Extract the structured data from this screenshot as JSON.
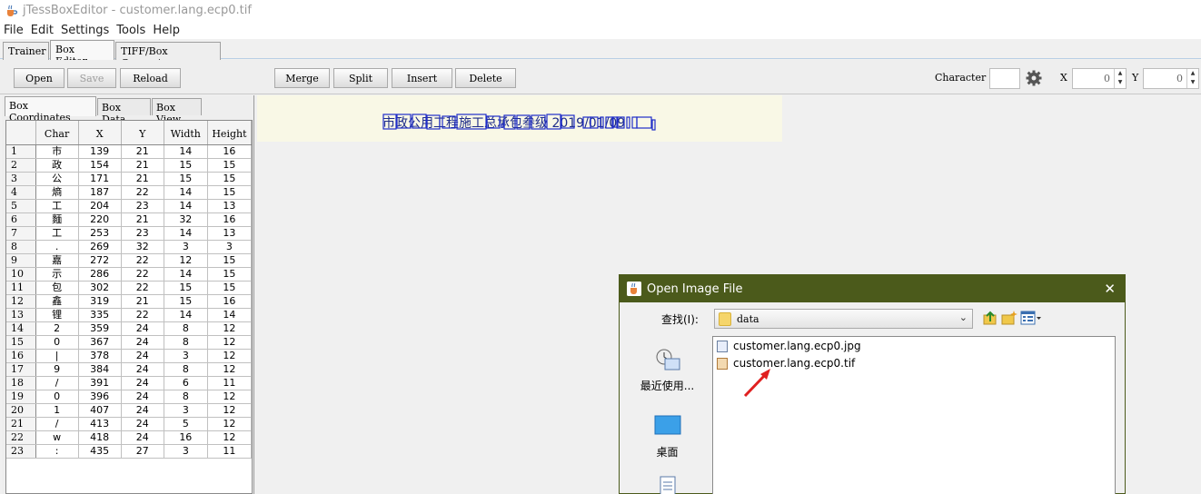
{
  "window": {
    "title": "jTessBoxEditor - customer.lang.ecp0.tif",
    "icon": "java-cup-icon"
  },
  "menubar": {
    "items": [
      "File",
      "Edit",
      "Settings",
      "Tools",
      "Help"
    ]
  },
  "main_tabs": {
    "items": [
      "Trainer",
      "Box Editor",
      "TIFF/Box Generator"
    ],
    "active": "Box Editor"
  },
  "toolbar": {
    "open": "Open",
    "save": "Save",
    "reload": "Reload",
    "merge": "Merge",
    "split": "Split",
    "insert": "Insert",
    "delete": "Delete",
    "character_label": "Character",
    "character_value": "",
    "x_label": "X",
    "x_value": "0",
    "y_label": "Y",
    "y_value": "0",
    "settings_icon": "gear-icon"
  },
  "left_tabs": {
    "items": [
      "Box Coordinates",
      "Box Data",
      "Box View"
    ],
    "active": "Box Coordinates"
  },
  "box_table": {
    "columns": [
      "",
      "Char",
      "X",
      "Y",
      "Width",
      "Height"
    ],
    "rows": [
      [
        "1",
        "市",
        "139",
        "21",
        "14",
        "16"
      ],
      [
        "2",
        "政",
        "154",
        "21",
        "15",
        "15"
      ],
      [
        "3",
        "公",
        "171",
        "21",
        "15",
        "15"
      ],
      [
        "4",
        "熵",
        "187",
        "22",
        "14",
        "15"
      ],
      [
        "5",
        "工",
        "204",
        "23",
        "14",
        "13"
      ],
      [
        "6",
        "麵",
        "220",
        "21",
        "32",
        "16"
      ],
      [
        "7",
        "工",
        "253",
        "23",
        "14",
        "13"
      ],
      [
        "8",
        ".",
        "269",
        "32",
        "3",
        "3"
      ],
      [
        "9",
        "嘉",
        "272",
        "22",
        "12",
        "15"
      ],
      [
        "10",
        "示",
        "286",
        "22",
        "14",
        "15"
      ],
      [
        "11",
        "包",
        "302",
        "22",
        "15",
        "15"
      ],
      [
        "12",
        "鑫",
        "319",
        "21",
        "15",
        "16"
      ],
      [
        "13",
        "锂",
        "335",
        "22",
        "14",
        "14"
      ],
      [
        "14",
        "2",
        "359",
        "24",
        "8",
        "12"
      ],
      [
        "15",
        "0",
        "367",
        "24",
        "8",
        "12"
      ],
      [
        "16",
        "|",
        "378",
        "24",
        "3",
        "12"
      ],
      [
        "17",
        "9",
        "384",
        "24",
        "8",
        "12"
      ],
      [
        "18",
        "/",
        "391",
        "24",
        "6",
        "11"
      ],
      [
        "19",
        "0",
        "396",
        "24",
        "8",
        "12"
      ],
      [
        "20",
        "1",
        "407",
        "24",
        "3",
        "12"
      ],
      [
        "21",
        "/",
        "413",
        "24",
        "5",
        "12"
      ],
      [
        "22",
        "w",
        "418",
        "24",
        "16",
        "12"
      ],
      [
        "23",
        ":",
        "435",
        "27",
        "3",
        "11"
      ]
    ]
  },
  "image_view": {
    "text": "市政公用工程施工总承包叁级  2019/01/09"
  },
  "dialog": {
    "title": "Open Image File",
    "look_in_label": "查找(I):",
    "look_in_value": "data",
    "places": [
      {
        "label": "最近使用...",
        "icon": "recent-items-icon"
      },
      {
        "label": "桌面",
        "icon": "desktop-icon"
      },
      {
        "label": "",
        "icon": "documents-icon"
      }
    ],
    "files": [
      {
        "name": "customer.lang.ecp0.jpg",
        "icon": "image-file-icon"
      },
      {
        "name": "customer.lang.ecp0.tif",
        "icon": "image-file-icon"
      }
    ],
    "toolbar_icons": [
      "up-folder-icon",
      "new-folder-icon",
      "view-menu-icon"
    ],
    "close_icon": "close-icon"
  },
  "colors": {
    "dialog_title": "#4b5a1b",
    "image_background": "#f9f8e6",
    "box_outline": "#1f2dc8",
    "annotation_arrow": "#e02020"
  }
}
